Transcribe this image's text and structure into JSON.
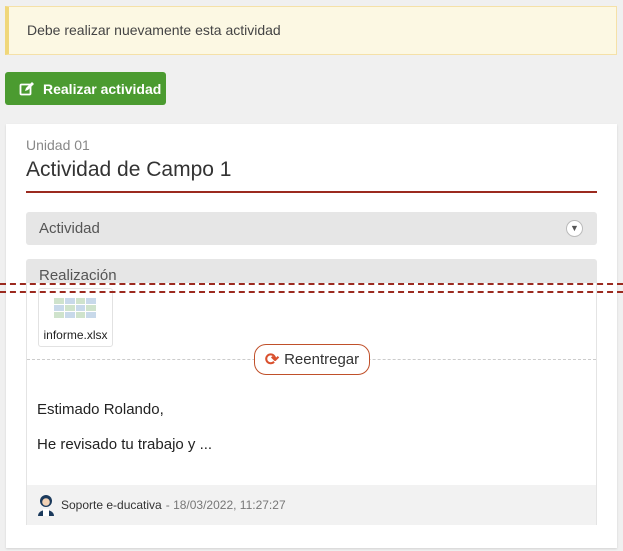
{
  "alert": {
    "text": "Debe realizar nuevamente esta actividad"
  },
  "actions": {
    "realizar_label": "Realizar actividad"
  },
  "activity": {
    "unit": "Unidad 01",
    "title": "Actividad de Campo 1",
    "sections": [
      {
        "label": "Actividad"
      },
      {
        "label": "Realización"
      }
    ]
  },
  "submission": {
    "file_name": "informe.xlsx",
    "resubmit_label": "Reentregar"
  },
  "feedback": {
    "line1": "Estimado Rolando,",
    "line2": "He revisado tu trabajo y ...",
    "author": "Soporte e-ducativa",
    "date": "- 18/03/2022, 11:27:27"
  },
  "colors": {
    "accent": "#9b2a1f",
    "primary_button": "#4b9b30",
    "alert_bg": "#fcf8e3"
  },
  "icons": {
    "edit": "edit-icon",
    "refresh": "refresh-icon",
    "chevron": "chevron-down-icon",
    "avatar": "user-avatar-icon"
  }
}
